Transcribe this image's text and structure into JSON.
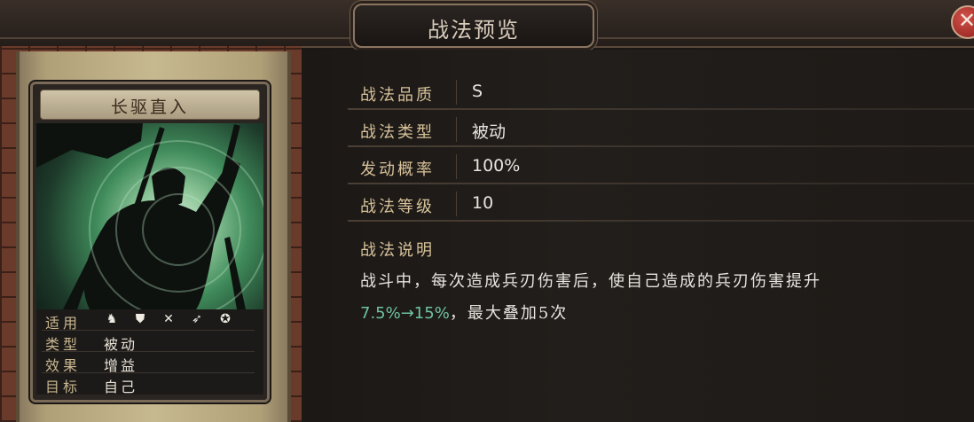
{
  "header": {
    "title": "战法预览",
    "close_icon": "close-icon"
  },
  "card": {
    "name": "长驱直入",
    "info": [
      {
        "key": "适用",
        "type": "icons",
        "icons": [
          "cavalry-icon",
          "shield-icon",
          "bow-icon",
          "spear-icon",
          "siege-icon"
        ]
      },
      {
        "key": "类型",
        "value": "被动"
      },
      {
        "key": "效果",
        "value": "增益"
      },
      {
        "key": "目标",
        "value": "自己"
      }
    ]
  },
  "attributes": [
    {
      "label": "战法品质",
      "value": "S"
    },
    {
      "label": "战法类型",
      "value": "被动"
    },
    {
      "label": "发动概率",
      "value": "100%"
    },
    {
      "label": "战法等级",
      "value": "10"
    }
  ],
  "description": {
    "title": "战法说明",
    "line1": "战斗中，每次造成兵刃伤害后，使自己造成的兵刃伤害提升",
    "highlight": "7.5%→15%",
    "line2_rest": "，最大叠加5次"
  },
  "colors": {
    "label": "#d8c39a",
    "value": "#e8e4de",
    "highlight": "#6fc2a3",
    "close": "#b3322b"
  }
}
